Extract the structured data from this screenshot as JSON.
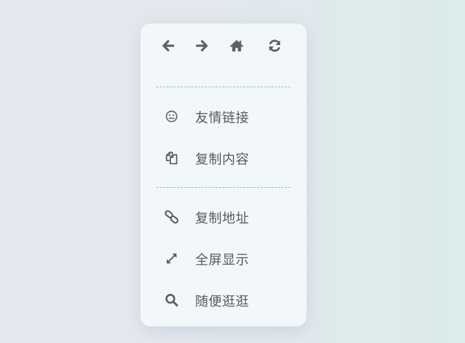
{
  "nav": {
    "back_icon": "arrow-left-icon",
    "forward_icon": "arrow-right-icon",
    "home_icon": "home-icon",
    "refresh_icon": "refresh-icon"
  },
  "menu": {
    "items": [
      {
        "label": "友情链接",
        "icon": "smile-icon"
      },
      {
        "label": "复制内容",
        "icon": "copy-icon"
      },
      {
        "label": "复制地址",
        "icon": "link-icon"
      },
      {
        "label": "全屏显示",
        "icon": "expand-icon"
      },
      {
        "label": "随便逛逛",
        "icon": "search-icon"
      }
    ]
  },
  "colors": {
    "icon": "#5f5f5f",
    "text": "#5a5a5a",
    "divider": "#8fb6c4",
    "panel": "#f2f8fa"
  }
}
